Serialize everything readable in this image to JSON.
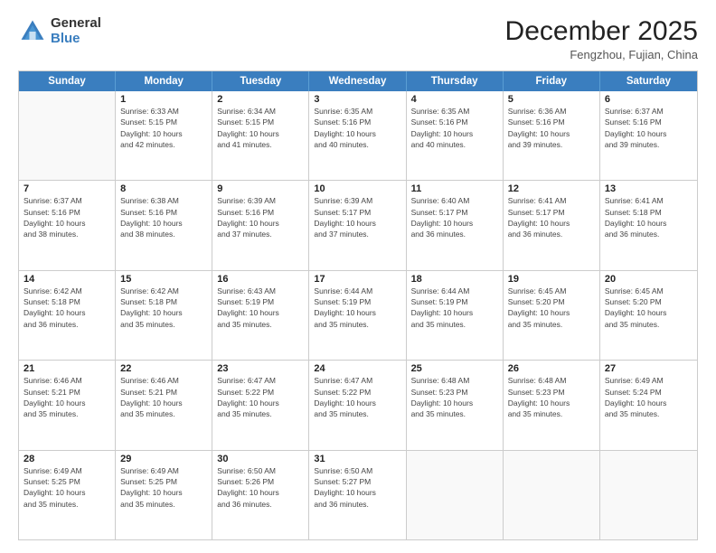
{
  "logo": {
    "general": "General",
    "blue": "Blue"
  },
  "title": {
    "month": "December 2025",
    "location": "Fengzhou, Fujian, China"
  },
  "headers": [
    "Sunday",
    "Monday",
    "Tuesday",
    "Wednesday",
    "Thursday",
    "Friday",
    "Saturday"
  ],
  "rows": [
    [
      {
        "day": "",
        "info": ""
      },
      {
        "day": "1",
        "info": "Sunrise: 6:33 AM\nSunset: 5:15 PM\nDaylight: 10 hours\nand 42 minutes."
      },
      {
        "day": "2",
        "info": "Sunrise: 6:34 AM\nSunset: 5:15 PM\nDaylight: 10 hours\nand 41 minutes."
      },
      {
        "day": "3",
        "info": "Sunrise: 6:35 AM\nSunset: 5:16 PM\nDaylight: 10 hours\nand 40 minutes."
      },
      {
        "day": "4",
        "info": "Sunrise: 6:35 AM\nSunset: 5:16 PM\nDaylight: 10 hours\nand 40 minutes."
      },
      {
        "day": "5",
        "info": "Sunrise: 6:36 AM\nSunset: 5:16 PM\nDaylight: 10 hours\nand 39 minutes."
      },
      {
        "day": "6",
        "info": "Sunrise: 6:37 AM\nSunset: 5:16 PM\nDaylight: 10 hours\nand 39 minutes."
      }
    ],
    [
      {
        "day": "7",
        "info": "Sunrise: 6:37 AM\nSunset: 5:16 PM\nDaylight: 10 hours\nand 38 minutes."
      },
      {
        "day": "8",
        "info": "Sunrise: 6:38 AM\nSunset: 5:16 PM\nDaylight: 10 hours\nand 38 minutes."
      },
      {
        "day": "9",
        "info": "Sunrise: 6:39 AM\nSunset: 5:16 PM\nDaylight: 10 hours\nand 37 minutes."
      },
      {
        "day": "10",
        "info": "Sunrise: 6:39 AM\nSunset: 5:17 PM\nDaylight: 10 hours\nand 37 minutes."
      },
      {
        "day": "11",
        "info": "Sunrise: 6:40 AM\nSunset: 5:17 PM\nDaylight: 10 hours\nand 36 minutes."
      },
      {
        "day": "12",
        "info": "Sunrise: 6:41 AM\nSunset: 5:17 PM\nDaylight: 10 hours\nand 36 minutes."
      },
      {
        "day": "13",
        "info": "Sunrise: 6:41 AM\nSunset: 5:18 PM\nDaylight: 10 hours\nand 36 minutes."
      }
    ],
    [
      {
        "day": "14",
        "info": "Sunrise: 6:42 AM\nSunset: 5:18 PM\nDaylight: 10 hours\nand 36 minutes."
      },
      {
        "day": "15",
        "info": "Sunrise: 6:42 AM\nSunset: 5:18 PM\nDaylight: 10 hours\nand 35 minutes."
      },
      {
        "day": "16",
        "info": "Sunrise: 6:43 AM\nSunset: 5:19 PM\nDaylight: 10 hours\nand 35 minutes."
      },
      {
        "day": "17",
        "info": "Sunrise: 6:44 AM\nSunset: 5:19 PM\nDaylight: 10 hours\nand 35 minutes."
      },
      {
        "day": "18",
        "info": "Sunrise: 6:44 AM\nSunset: 5:19 PM\nDaylight: 10 hours\nand 35 minutes."
      },
      {
        "day": "19",
        "info": "Sunrise: 6:45 AM\nSunset: 5:20 PM\nDaylight: 10 hours\nand 35 minutes."
      },
      {
        "day": "20",
        "info": "Sunrise: 6:45 AM\nSunset: 5:20 PM\nDaylight: 10 hours\nand 35 minutes."
      }
    ],
    [
      {
        "day": "21",
        "info": "Sunrise: 6:46 AM\nSunset: 5:21 PM\nDaylight: 10 hours\nand 35 minutes."
      },
      {
        "day": "22",
        "info": "Sunrise: 6:46 AM\nSunset: 5:21 PM\nDaylight: 10 hours\nand 35 minutes."
      },
      {
        "day": "23",
        "info": "Sunrise: 6:47 AM\nSunset: 5:22 PM\nDaylight: 10 hours\nand 35 minutes."
      },
      {
        "day": "24",
        "info": "Sunrise: 6:47 AM\nSunset: 5:22 PM\nDaylight: 10 hours\nand 35 minutes."
      },
      {
        "day": "25",
        "info": "Sunrise: 6:48 AM\nSunset: 5:23 PM\nDaylight: 10 hours\nand 35 minutes."
      },
      {
        "day": "26",
        "info": "Sunrise: 6:48 AM\nSunset: 5:23 PM\nDaylight: 10 hours\nand 35 minutes."
      },
      {
        "day": "27",
        "info": "Sunrise: 6:49 AM\nSunset: 5:24 PM\nDaylight: 10 hours\nand 35 minutes."
      }
    ],
    [
      {
        "day": "28",
        "info": "Sunrise: 6:49 AM\nSunset: 5:25 PM\nDaylight: 10 hours\nand 35 minutes."
      },
      {
        "day": "29",
        "info": "Sunrise: 6:49 AM\nSunset: 5:25 PM\nDaylight: 10 hours\nand 35 minutes."
      },
      {
        "day": "30",
        "info": "Sunrise: 6:50 AM\nSunset: 5:26 PM\nDaylight: 10 hours\nand 36 minutes."
      },
      {
        "day": "31",
        "info": "Sunrise: 6:50 AM\nSunset: 5:27 PM\nDaylight: 10 hours\nand 36 minutes."
      },
      {
        "day": "",
        "info": ""
      },
      {
        "day": "",
        "info": ""
      },
      {
        "day": "",
        "info": ""
      }
    ]
  ]
}
